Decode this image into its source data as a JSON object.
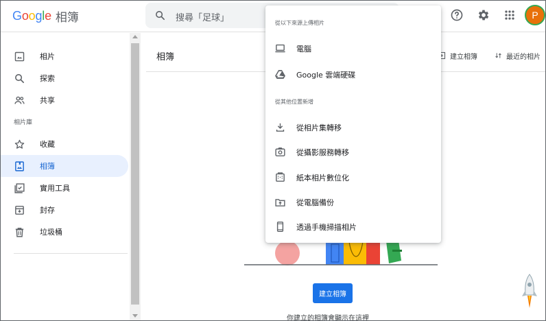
{
  "app": {
    "logo_text": "Google",
    "product_name": "相簿",
    "colors": {
      "accent": "#1a73e8",
      "active_bg": "#e8f0fe",
      "active_text": "#1967d2",
      "avatar_bg": "#e8710a"
    }
  },
  "header": {
    "search_placeholder": "搜尋「足球」",
    "icons": [
      "search-icon",
      "help-icon",
      "settings-icon",
      "apps-icon"
    ],
    "avatar_letter": "P"
  },
  "sidebar": {
    "items": [
      {
        "label": "相片",
        "icon": "photo-icon"
      },
      {
        "label": "探索",
        "icon": "search-icon"
      },
      {
        "label": "共享",
        "icon": "people-icon"
      }
    ],
    "library_label": "相片庫",
    "library_items": [
      {
        "label": "收藏",
        "icon": "star-icon"
      },
      {
        "label": "相簿",
        "icon": "album-icon",
        "active": true
      },
      {
        "label": "實用工具",
        "icon": "checklist-icon"
      },
      {
        "label": "封存",
        "icon": "archive-icon"
      },
      {
        "label": "垃圾桶",
        "icon": "trash-icon"
      }
    ]
  },
  "main": {
    "title": "相簿",
    "create_album_label": "建立相簿",
    "recent_photos_label": "最近的相片",
    "create_button": "建立相簿",
    "empty_text": "你建立的相簿會顯示在這裡"
  },
  "upload_menu": {
    "header_upload": "從以下來源上傳相片",
    "upload_items": [
      {
        "label": "電腦",
        "icon": "laptop-icon"
      },
      {
        "label": "Google 雲端硬碟",
        "icon": "google-drive-icon"
      }
    ],
    "header_add": "從其他位置新增",
    "add_items": [
      {
        "label": "從相片集轉移",
        "icon": "download-icon"
      },
      {
        "label": "從攝影服務轉移",
        "icon": "camera-transfer-icon"
      },
      {
        "label": "紙本相片數位化",
        "icon": "scan-photo-icon"
      },
      {
        "label": "從電腦備份",
        "icon": "backup-icon"
      },
      {
        "label": "透過手機掃描相片",
        "icon": "phone-icon"
      }
    ]
  }
}
